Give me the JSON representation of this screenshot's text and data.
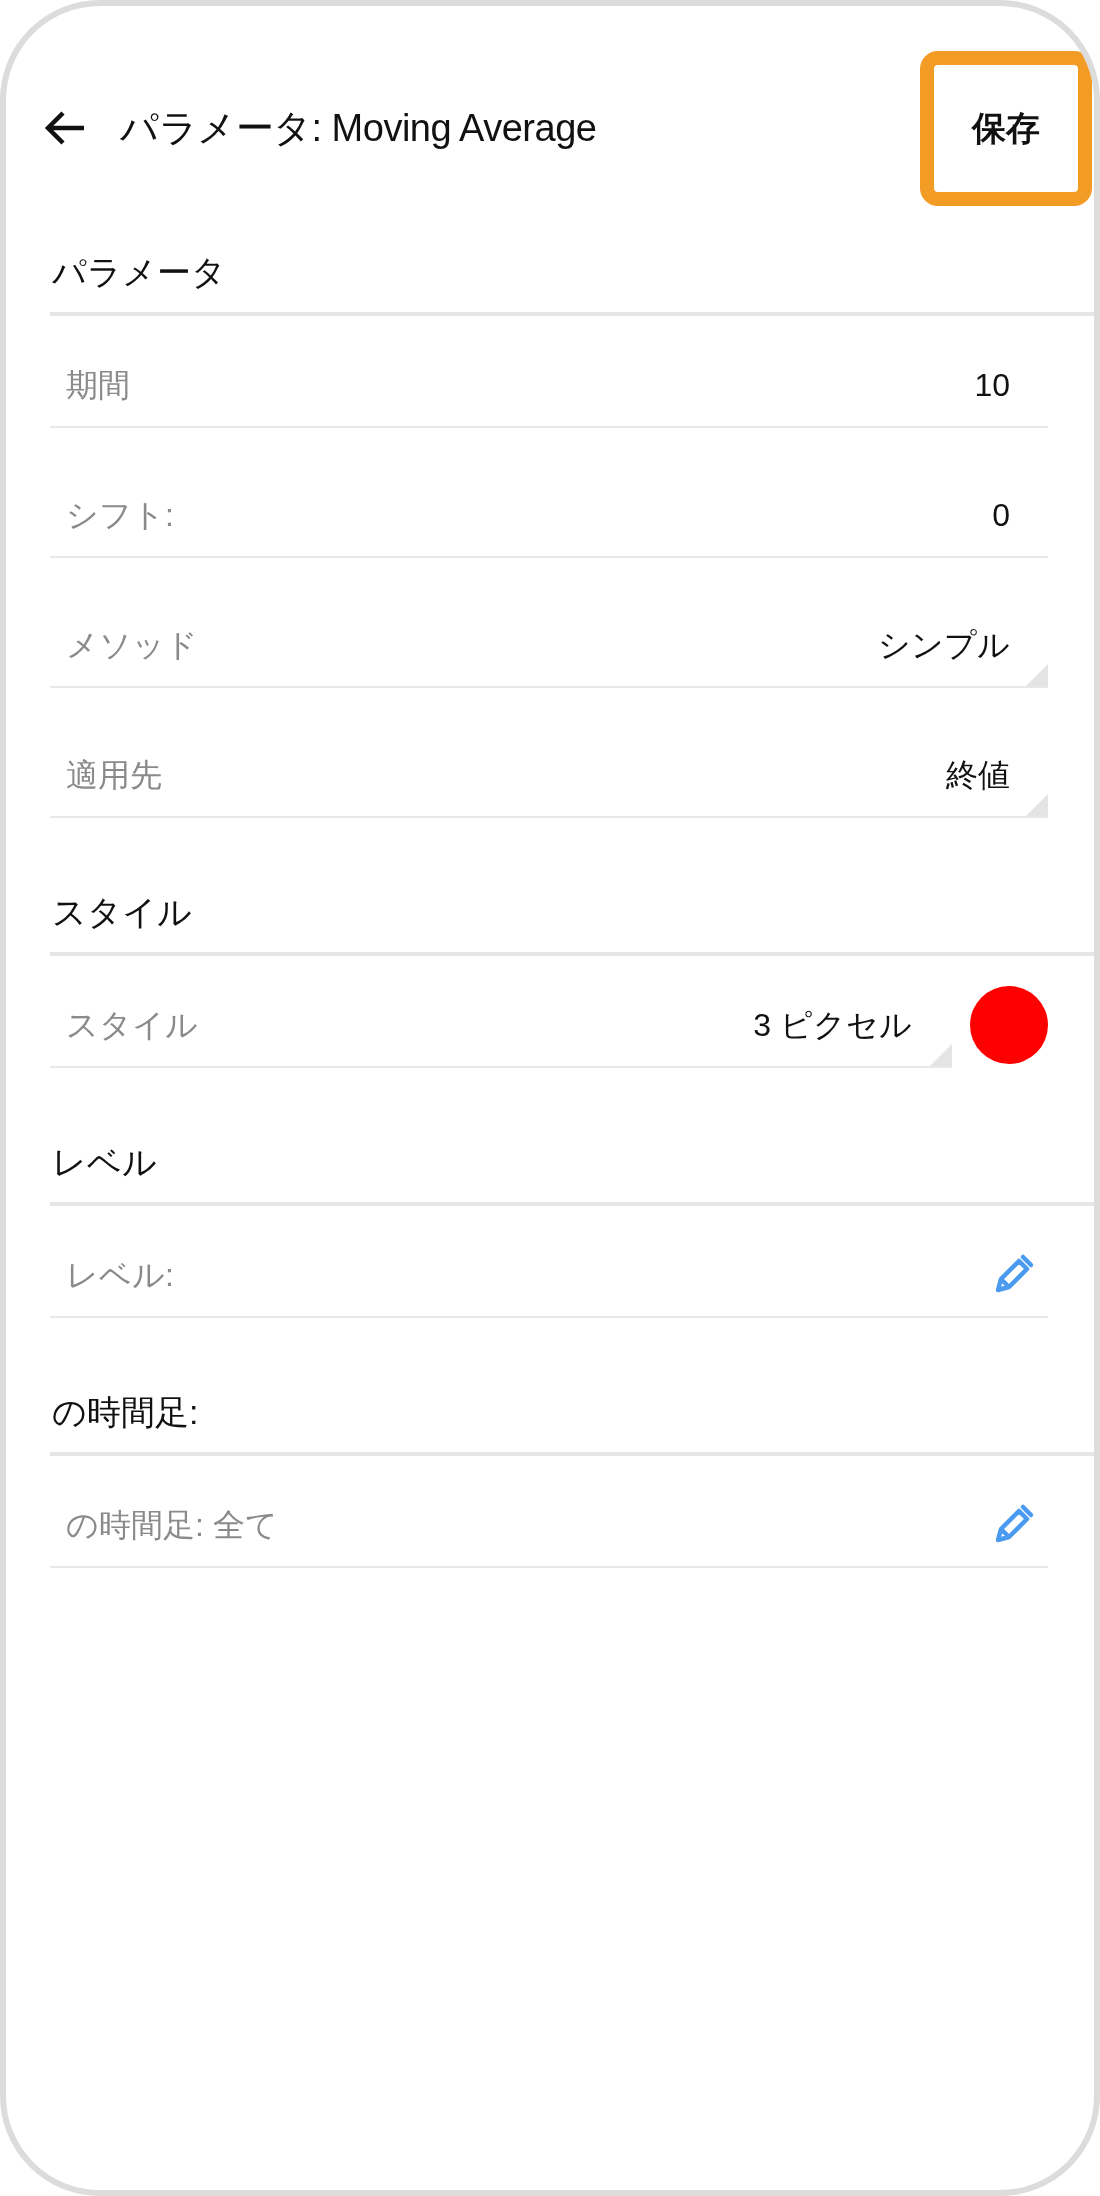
{
  "header": {
    "title": "パラメータ: Moving Average",
    "save_button": {
      "label": "保存",
      "highlighted": true
    }
  },
  "sections": [
    {
      "title": "パラメータ",
      "rows": [
        {
          "kind": "value",
          "label": "期間",
          "value": "10"
        },
        {
          "kind": "value",
          "label": "シフト:",
          "value": "0"
        },
        {
          "kind": "dropdown",
          "label": "メソッド",
          "value": "シンプル"
        },
        {
          "kind": "dropdown",
          "label": "適用先",
          "value": "終値"
        }
      ]
    },
    {
      "title": "スタイル",
      "rows": [
        {
          "kind": "style",
          "label": "スタイル",
          "value": "3 ピクセル",
          "color": "#ff0000"
        }
      ]
    },
    {
      "title": "レベル",
      "rows": [
        {
          "kind": "edit",
          "label": "レベル:"
        }
      ]
    },
    {
      "title": "の時間足:",
      "rows": [
        {
          "kind": "edit",
          "label": "の時間足:  全て"
        }
      ]
    }
  ]
}
